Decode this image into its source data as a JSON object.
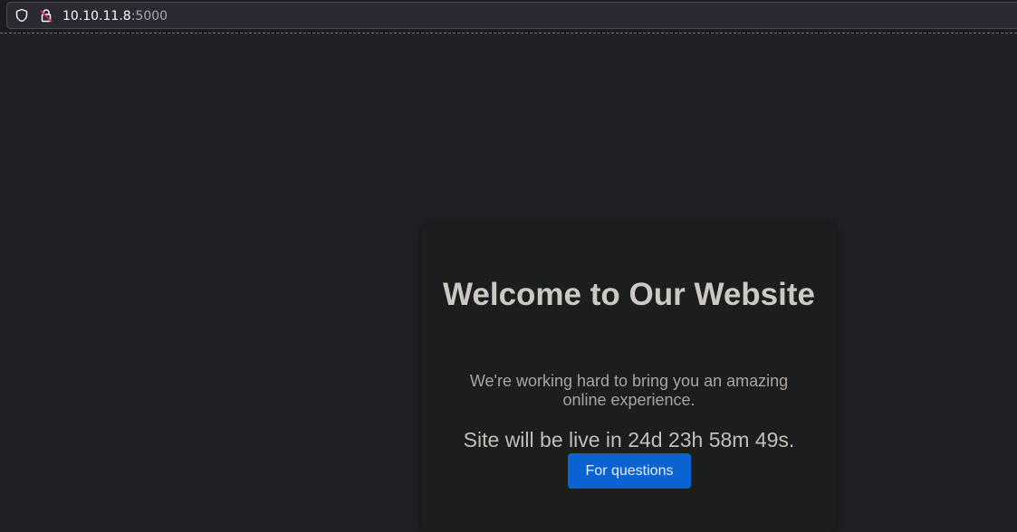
{
  "browser": {
    "url_host": "10.10.11.8",
    "url_port": ":5000",
    "icons": {
      "tracking_protection": "shield-icon",
      "connection": "insecure-lock-icon"
    }
  },
  "page": {
    "title": "Welcome to Our Website",
    "subtitle": "We're working hard to bring you an amazing online experience.",
    "countdown": "Site will be live in 24d 23h 58m 49s.",
    "button_label": "For questions"
  },
  "colors": {
    "background": "#1f2023",
    "card": "#1c1d1f",
    "button": "#0b62d1",
    "lock_warning": "#e22850"
  }
}
